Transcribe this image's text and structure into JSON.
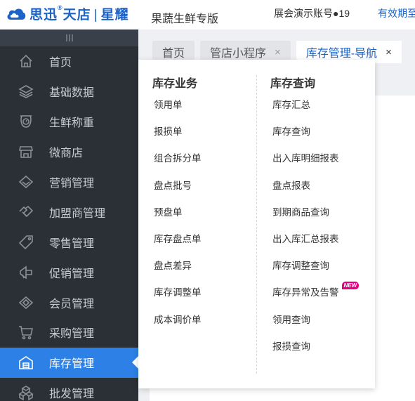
{
  "header": {
    "logo_text_1": "思迅",
    "logo_text_2": "天店",
    "logo_separator": "|",
    "logo_text_3": "星耀",
    "edition": "果蔬生鲜专版",
    "account": "展会演示账号●19",
    "validity": "有效期至"
  },
  "sidebar": {
    "items": [
      {
        "label": "首页",
        "icon": "home-icon"
      },
      {
        "label": "基础数据",
        "icon": "layers-icon"
      },
      {
        "label": "生鲜称重",
        "icon": "scale-icon"
      },
      {
        "label": "微商店",
        "icon": "shop-icon"
      },
      {
        "label": "营销管理",
        "icon": "diamond-icon"
      },
      {
        "label": "加盟商管理",
        "icon": "handshake-icon"
      },
      {
        "label": "零售管理",
        "icon": "tag-icon"
      },
      {
        "label": "促销管理",
        "icon": "megaphone-icon"
      },
      {
        "label": "会员管理",
        "icon": "gem-icon"
      },
      {
        "label": "采购管理",
        "icon": "cart-icon"
      },
      {
        "label": "库存管理",
        "icon": "warehouse-icon",
        "active": true
      },
      {
        "label": "批发管理",
        "icon": "boxes-icon"
      }
    ]
  },
  "tabs": [
    {
      "label": "首页",
      "closable": false
    },
    {
      "label": "管店小程序",
      "closable": true,
      "close": "×"
    },
    {
      "label": "库存管理-导航",
      "closable": true,
      "close": "×",
      "active": true
    }
  ],
  "dropdown": {
    "left_title": "库存业务",
    "left_items": [
      "领用单",
      "报损单",
      "组合拆分单",
      "盘点批号",
      "预盘单",
      "库存盘点单",
      "盘点差异",
      "库存调整单",
      "成本调价单"
    ],
    "right_title": "库存查询",
    "right_items": [
      "库存汇总",
      "库存查询",
      "出入库明细报表",
      "盘点报表",
      "到期商品查询",
      "出入库汇总报表",
      "库存调整查询",
      "库存异常及告警",
      "领用查询",
      "报损查询"
    ],
    "new_badge": "NEW"
  },
  "colors": {
    "brand": "#1c63c8",
    "sidebar_bg": "#2b3037",
    "active_bg": "#2d80e6",
    "badge": "#e4007f"
  }
}
